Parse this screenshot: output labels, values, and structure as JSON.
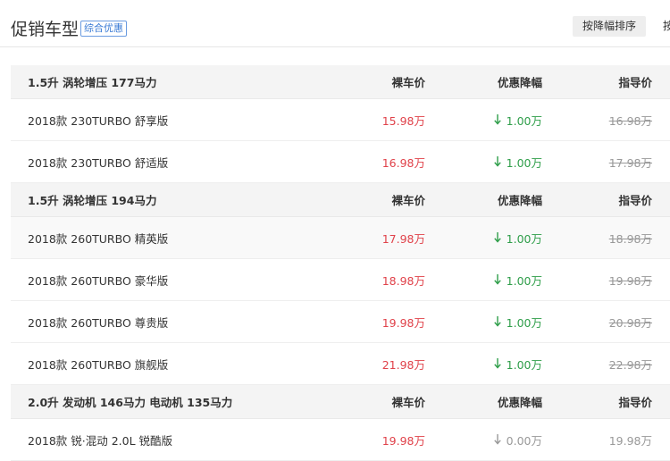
{
  "header": {
    "title": "促销车型",
    "badge": "综合优惠",
    "sort_label": "按降幅排序",
    "sort2_label": "按"
  },
  "colors": {
    "price": "#e0424a",
    "discount": "#2f9e4a",
    "discount_zero": "#999999",
    "guide": "#999999"
  },
  "groups": [
    {
      "name": "1.5升 涡轮增压 177马力",
      "col_price": "裸车价",
      "col_discount": "优惠降幅",
      "col_guide": "指导价",
      "rows": [
        {
          "model": "2018款 230TURBO 舒享版",
          "price": "15.98万",
          "discount": "1.00万",
          "guide": "16.98万"
        },
        {
          "model": "2018款 230TURBO 舒适版",
          "price": "16.98万",
          "discount": "1.00万",
          "guide": "17.98万"
        }
      ]
    },
    {
      "name": "1.5升 涡轮增压 194马力",
      "col_price": "裸车价",
      "col_discount": "优惠降幅",
      "col_guide": "指导价",
      "rows": [
        {
          "model": "2018款 260TURBO 精英版",
          "price": "17.98万",
          "discount": "1.00万",
          "guide": "18.98万"
        },
        {
          "model": "2018款 260TURBO 豪华版",
          "price": "18.98万",
          "discount": "1.00万",
          "guide": "19.98万"
        },
        {
          "model": "2018款 260TURBO 尊贵版",
          "price": "19.98万",
          "discount": "1.00万",
          "guide": "20.98万"
        },
        {
          "model": "2018款 260TURBO 旗舰版",
          "price": "21.98万",
          "discount": "1.00万",
          "guide": "22.98万"
        }
      ]
    },
    {
      "name": "2.0升 发动机 146马力 电动机 135马力",
      "col_price": "裸车价",
      "col_discount": "优惠降幅",
      "col_guide": "指导价",
      "rows": [
        {
          "model": "2018款 锐·混动 2.0L 锐酷版",
          "price": "19.98万",
          "discount": "0.00万",
          "guide": "19.98万"
        }
      ]
    }
  ]
}
